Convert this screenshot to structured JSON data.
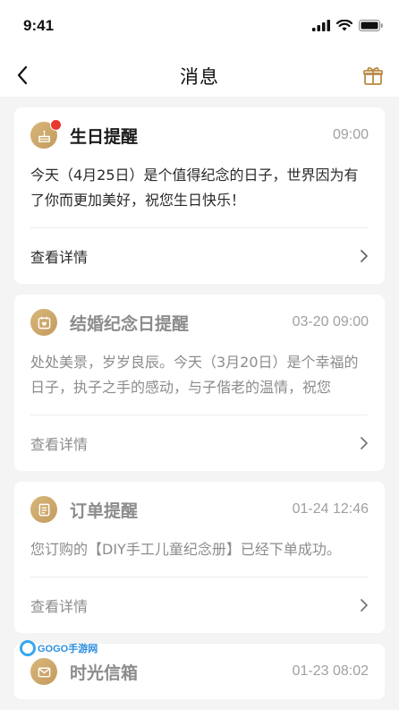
{
  "status_bar": {
    "time": "9:41"
  },
  "nav": {
    "title": "消息",
    "back_icon": "chevron-left-icon",
    "gift_icon": "gift-icon"
  },
  "messages": [
    {
      "title": "生日提醒",
      "time": "09:00",
      "body": "今天（4月25日）是个值得纪念的日子，世界因为有了你而更加美好，祝您生日快乐！",
      "action": "查看详情",
      "icon": "cake-icon",
      "unread": true
    },
    {
      "title": "结婚纪念日提醒",
      "time": "03-20 09:00",
      "body": "处处美景，岁岁良辰。今天（3月20日）是个幸福的日子，执子之手的感动，与子偕老的温情，祝您",
      "action": "查看详情",
      "icon": "calendar-heart-icon",
      "unread": false
    },
    {
      "title": "订单提醒",
      "time": "01-24 12:46",
      "body": "您订购的【DIY手工儿童纪念册】已经下单成功。",
      "action": "查看详情",
      "icon": "list-icon",
      "unread": false
    },
    {
      "title": "时光信箱",
      "time": "01-23 08:02",
      "icon": "mail-icon",
      "unread": false
    }
  ],
  "watermark": {
    "text": "GOGO手游网"
  },
  "colors": {
    "accent_gold": "#c9a264",
    "unread_red": "#e8382f",
    "background": "#f4f4f4"
  }
}
